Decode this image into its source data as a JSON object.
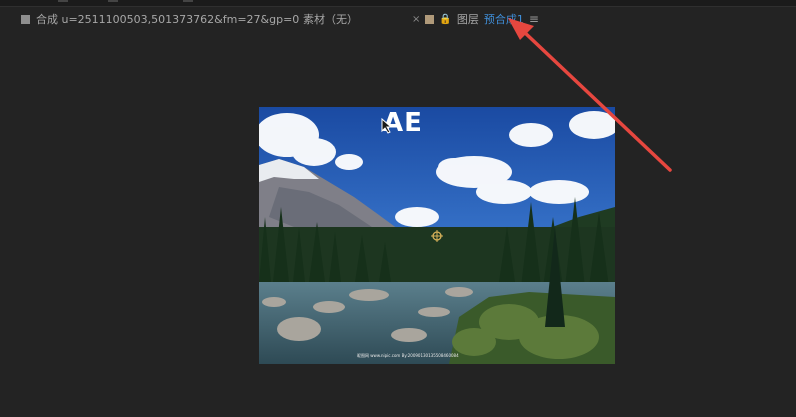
{
  "window": {
    "tabs": [
      {
        "label": "合成 u=2511100503,501373762&fm=27&gp=0"
      },
      {
        "label": "素材（无）"
      }
    ],
    "layer_tab": {
      "close": "×",
      "label": "图层",
      "precomp_label": "预合成1",
      "menu": "≡"
    }
  },
  "composition": {
    "text_layer": "AE",
    "watermark": "昵图网 www.nipic.com  By:20090130135508460084"
  },
  "colors": {
    "background": "#232323",
    "active_tab_underline": "#b9b9b9",
    "link_blue": "#3f8ed8",
    "annotation_arrow": "#e6473f"
  }
}
